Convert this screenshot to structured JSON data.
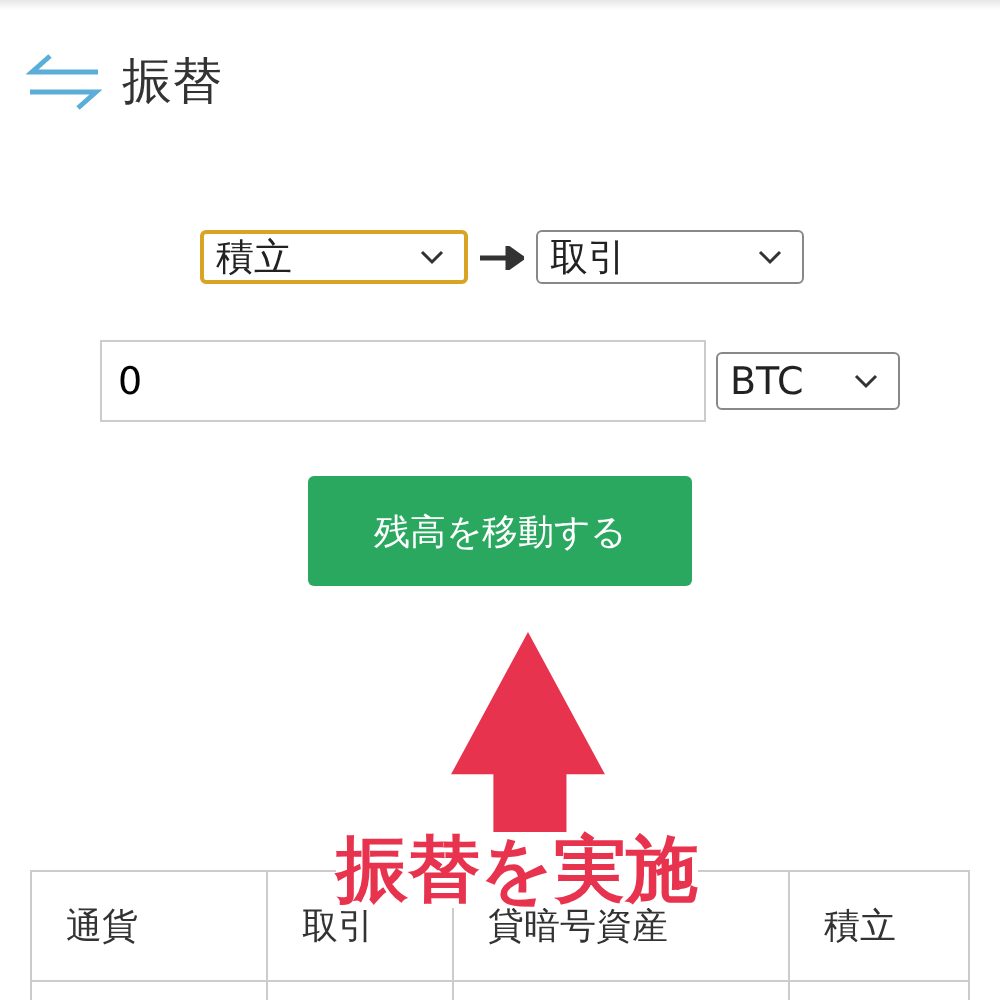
{
  "header": {
    "title": "振替"
  },
  "transfer": {
    "from": {
      "value": "積立",
      "focused": true
    },
    "to": {
      "value": "取引",
      "focused": false
    },
    "amount": {
      "value": "0"
    },
    "currency": {
      "value": "BTC",
      "focused": false
    }
  },
  "button": {
    "label": "残高を移動する"
  },
  "table": {
    "columns": [
      "通貨",
      "取引",
      "貸暗号資産",
      "積立"
    ]
  },
  "annotation": {
    "text": "振替を実施"
  }
}
